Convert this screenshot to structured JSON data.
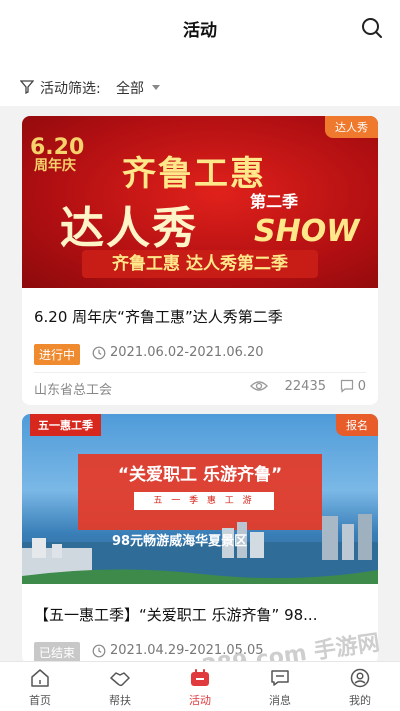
{
  "header": {
    "title": "活动"
  },
  "filter": {
    "label": "活动筛选:",
    "value": "全部"
  },
  "cards": [
    {
      "corner_tag": "达人秀",
      "banner": {
        "anniv_num": "6.20",
        "anniv_text": "周年庆",
        "line1": "齐鲁工惠",
        "line2": "达人秀",
        "season": "第二季",
        "show": "SHOW",
        "sub": "齐鲁工惠 达人秀第二季"
      },
      "title": "6.20 周年庆“齐鲁工惠”达人秀第二季",
      "status": "进行中",
      "dates": "2021.06.02-2021.06.20",
      "org": "山东省总工会",
      "views": "22435",
      "comments": "0"
    },
    {
      "corner_tag": "报名",
      "banner": {
        "ribbon": "五一惠工季",
        "title": "“关爱职工 乐游齐鲁”",
        "sub": "五 一 季 惠 工 游",
        "blurb": "98元畅游威海华夏景区"
      },
      "title": "【五一惠工季】“关爱职工 乐游齐鲁” 98...",
      "status": "已结束",
      "dates": "2021.04.29-2021.05.05"
    }
  ],
  "tabs": [
    {
      "label": "首页",
      "icon": "home-icon"
    },
    {
      "label": "帮扶",
      "icon": "handshake-icon"
    },
    {
      "label": "活动",
      "icon": "activity-icon"
    },
    {
      "label": "消息",
      "icon": "message-icon"
    },
    {
      "label": "我的",
      "icon": "profile-icon"
    }
  ],
  "watermark": "289.com 手游网",
  "colors": {
    "accent": "#e03a3e",
    "status_active": "#ef8a2e",
    "status_ended": "#c8c8c8"
  }
}
